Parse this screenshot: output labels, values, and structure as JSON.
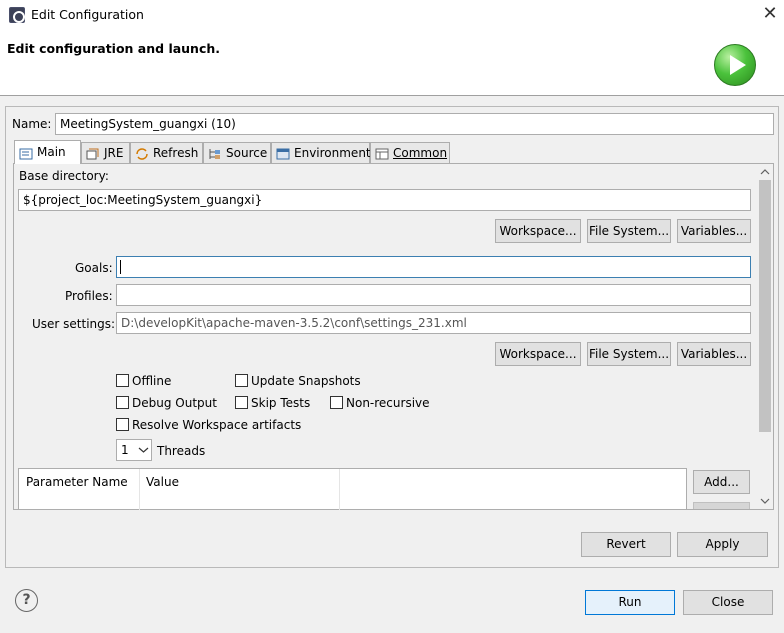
{
  "window": {
    "title": "Edit Configuration",
    "close_glyph": "✕"
  },
  "header": {
    "title": "Edit configuration and launch."
  },
  "name_field": {
    "label": "Name:",
    "value": "MeetingSystem_guangxi (10)"
  },
  "tabs": [
    {
      "label": "Main",
      "icon": "main-tab-icon"
    },
    {
      "label": "JRE",
      "icon": "jre-icon"
    },
    {
      "label": "Refresh",
      "icon": "refresh-icon"
    },
    {
      "label": "Source",
      "icon": "source-icon"
    },
    {
      "label": "Environment",
      "icon": "environment-icon"
    },
    {
      "label": "Common",
      "icon": "common-icon"
    }
  ],
  "main": {
    "base_dir_label": "Base directory:",
    "base_dir_value": "${project_loc:MeetingSystem_guangxi}",
    "workspace_btn": "Workspace...",
    "filesystem_btn": "File System...",
    "variables_btn": "Variables...",
    "goals_label": "Goals:",
    "goals_value": "",
    "profiles_label": "Profiles:",
    "profiles_value": "",
    "user_settings_label": "User settings:",
    "user_settings_value": "D:\\developKit\\apache-maven-3.5.2\\conf\\settings_231.xml",
    "offline": "Offline",
    "update_snapshots": "Update Snapshots",
    "debug_output": "Debug Output",
    "skip_tests": "Skip Tests",
    "non_recursive": "Non-recursive",
    "resolve_workspace": "Resolve Workspace artifacts",
    "threads_value": "1",
    "threads_label": "Threads",
    "param_col_name": "Parameter Name",
    "param_col_value": "Value",
    "add_btn": "Add..."
  },
  "footer": {
    "revert": "Revert",
    "apply": "Apply",
    "run": "Run",
    "close": "Close",
    "help_glyph": "?"
  }
}
